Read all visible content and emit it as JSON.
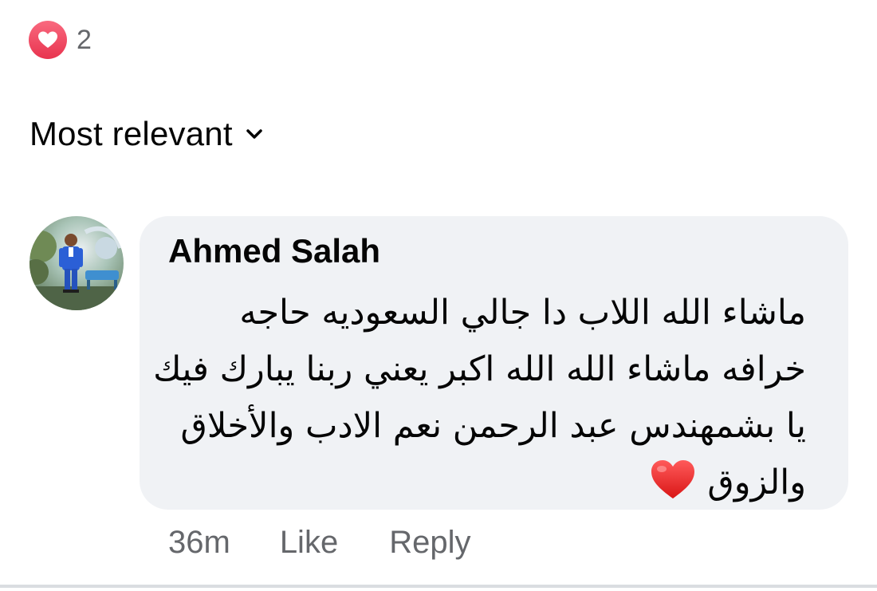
{
  "reactions": {
    "icon": "love-reaction-icon",
    "count": "2",
    "color": "#e8344f"
  },
  "sort": {
    "label": "Most relevant",
    "icon": "chevron-down-icon"
  },
  "comment": {
    "author": "Ahmed Salah",
    "avatar": "avatar",
    "lines": [
      "ماشاء الله اللاب  دا جالي السعوديه حاجه",
      "خرافه ماشاء الله الله اكبر يعني ربنا يبارك فيك",
      "يا بشمهندس عبد الرحمن نعم الادب والأخلاق",
      "والزوق"
    ],
    "trailing_emoji": "red-heart-icon",
    "time": "36m",
    "like_label": "Like",
    "reply_label": "Reply"
  },
  "colors": {
    "bubble": "#f0f2f5",
    "secondary_text": "#65676b",
    "primary_text": "#050505"
  }
}
